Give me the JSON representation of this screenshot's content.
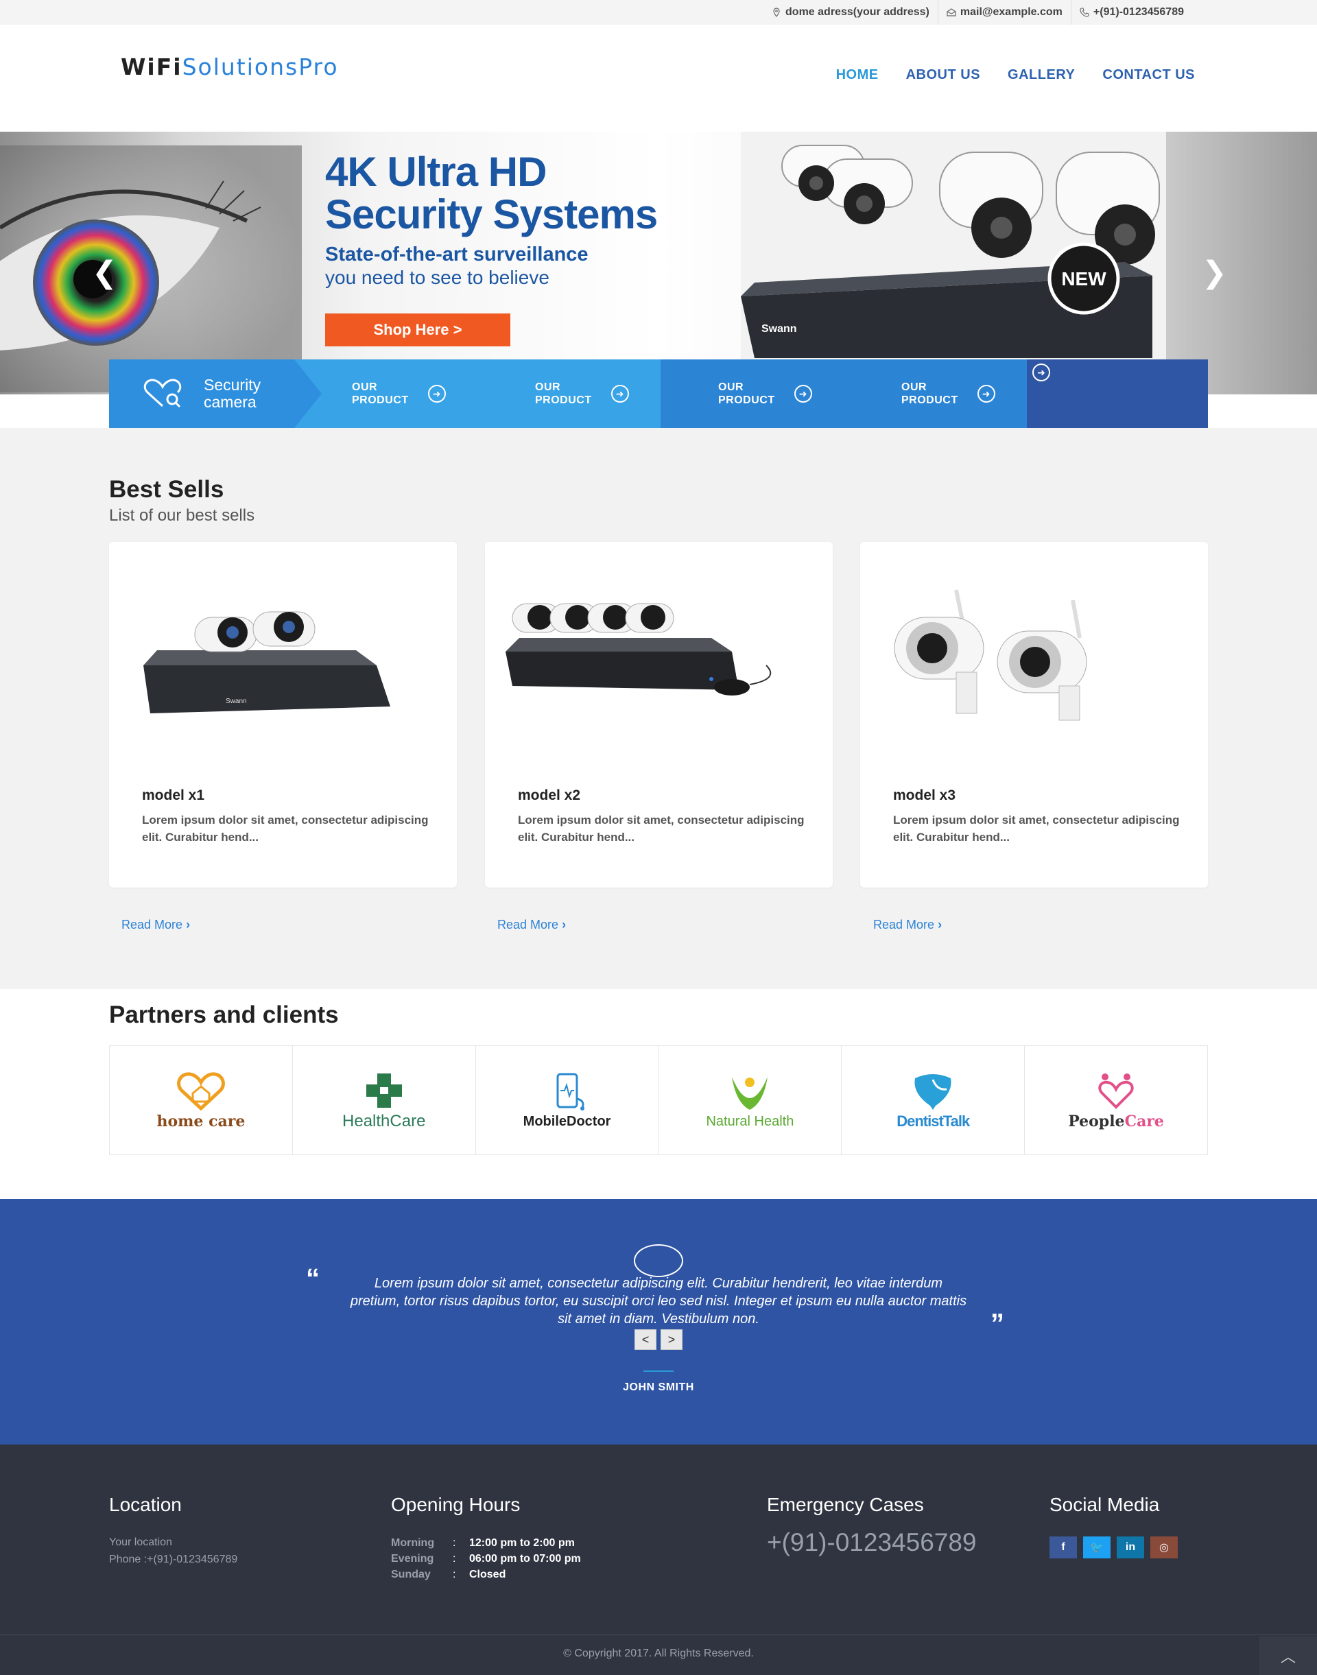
{
  "topbar": {
    "address": "dome adress(your address)",
    "email": "mail@example.com",
    "phone": "+(91)-0123456789"
  },
  "header": {
    "logo_dark": "WiFi",
    "logo_blue": "SolutionsPro",
    "nav": [
      "HOME",
      "ABOUT US",
      "GALLERY",
      "CONTACT US"
    ]
  },
  "hero": {
    "title_line1": "4K Ultra HD",
    "title_line2": "Security Systems",
    "subtitle1": "State-of-the-art surveillance",
    "subtitle2": "you need to see to believe",
    "button": "Shop Here >",
    "badge": "NEW",
    "brand": "Swann"
  },
  "strip": {
    "first_line1": "Security",
    "first_line2": "camera",
    "items": [
      {
        "line1": "OUR",
        "line2": "PRODUCT"
      },
      {
        "line1": "OUR",
        "line2": "PRODUCT"
      },
      {
        "line1": "OUR",
        "line2": "PRODUCT"
      },
      {
        "line1": "OUR",
        "line2": "PRODUCT"
      }
    ]
  },
  "best": {
    "title": "Best Sells",
    "subtitle": "List of our best sells",
    "products": [
      {
        "name": "model x1",
        "desc": "Lorem ipsum dolor sit amet, consectetur adipiscing elit. Curabitur hend...",
        "link": "Read More"
      },
      {
        "name": "model x2",
        "desc": "Lorem ipsum dolor sit amet, consectetur adipiscing elit. Curabitur hend...",
        "link": "Read More"
      },
      {
        "name": "model x3",
        "desc": "Lorem ipsum dolor sit amet, consectetur adipiscing elit. Curabitur hend...",
        "link": "Read More"
      }
    ]
  },
  "partners": {
    "title": "Partners and clients",
    "logos": [
      {
        "name": "home care",
        "color": "#8a4a1a"
      },
      {
        "name": "HealthCare",
        "color": "#2a7a5a"
      },
      {
        "name": "MobileDoctor",
        "color": "#222222"
      },
      {
        "name": "Natural Health",
        "color": "#5aa832"
      },
      {
        "name": "DentistTalk",
        "color": "#2a8ad0"
      },
      {
        "name": "People",
        "name2": "Care",
        "color": "#333333"
      }
    ]
  },
  "testimonial": {
    "quote": "Lorem ipsum dolor sit amet, consectetur adipiscing elit. Curabitur hendrerit, leo vitae interdum pretium, tortor risus dapibus tortor, eu suscipit orci leo sed nisl. Integer et ipsum eu nulla auctor mattis sit amet in diam. Vestibulum non.",
    "author": "JOHN SMITH",
    "prev": "<",
    "next": ">"
  },
  "footer": {
    "location_title": "Location",
    "location_line1": "Your location",
    "location_line2": "Phone :+(91)-0123456789",
    "hours_title": "Opening Hours",
    "hours": [
      {
        "day": "Morning",
        "time": "12:00 pm to 2:00 pm"
      },
      {
        "day": "Evening",
        "time": "06:00 pm to 07:00 pm"
      },
      {
        "day": "Sunday",
        "time": "Closed"
      }
    ],
    "emergency_title": "Emergency Cases",
    "emergency_phone": "+(91)-0123456789",
    "social_title": "Social Media",
    "social": [
      {
        "icon": "f",
        "name": "facebook",
        "color": "#3b5998"
      },
      {
        "icon": "t",
        "name": "twitter",
        "color": "#1da1f2"
      },
      {
        "icon": "in",
        "name": "linkedin",
        "color": "#0e76a8"
      },
      {
        "icon": "o",
        "name": "instagram",
        "color": "#8a4a3a"
      }
    ],
    "copyright": "© Copyright 2017. All Rights Reserved."
  },
  "colors": {
    "brand_blue": "#1b56a3",
    "accent_blue": "#2a82d8",
    "orange": "#f05a22",
    "testimonial_bg": "#2f54a4",
    "footer_bg": "#2f3440"
  }
}
